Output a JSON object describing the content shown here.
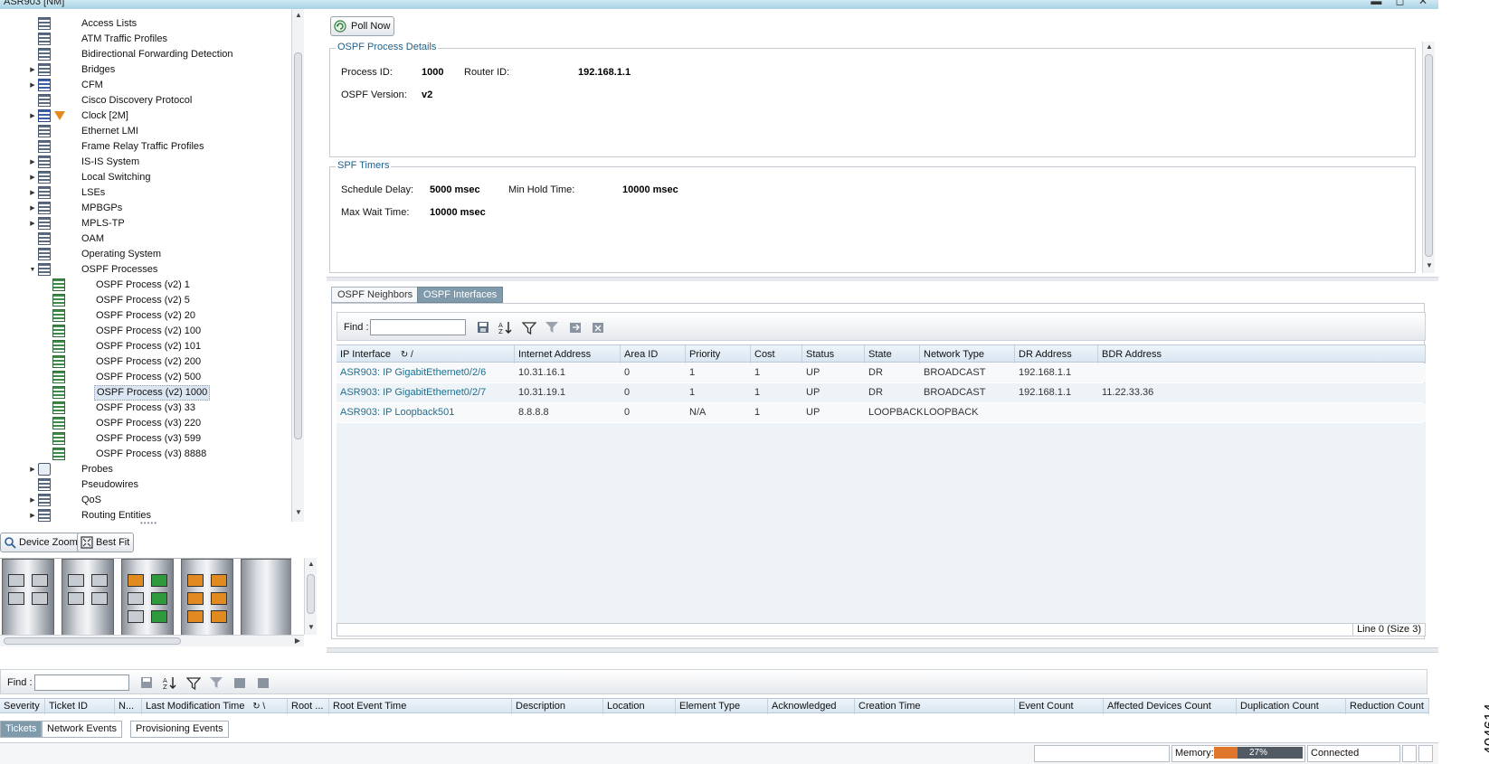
{
  "window": {
    "title": "ASR903 [NM]"
  },
  "tree": {
    "items": [
      {
        "label": "Access Lists",
        "expand": false,
        "icon": "table-icon"
      },
      {
        "label": "ATM Traffic Profiles",
        "expand": false,
        "icon": "table-icon"
      },
      {
        "label": "Bidirectional Forwarding Detection",
        "expand": false,
        "icon": "table-icon"
      },
      {
        "label": "Bridges",
        "expand": true,
        "icon": "table-icon"
      },
      {
        "label": "CFM",
        "expand": true,
        "icon": "cfm-icon"
      },
      {
        "label": "Cisco Discovery Protocol",
        "expand": false,
        "icon": "table-icon"
      },
      {
        "label": "Clock [2M]",
        "expand": true,
        "icon": "clock-icon"
      },
      {
        "label": "Ethernet LMI",
        "expand": false,
        "icon": "table-icon"
      },
      {
        "label": "Frame Relay Traffic Profiles",
        "expand": false,
        "icon": "table-icon"
      },
      {
        "label": "IS-IS System",
        "expand": true,
        "icon": "table-icon"
      },
      {
        "label": "Local Switching",
        "expand": true,
        "icon": "table-icon"
      },
      {
        "label": "LSEs",
        "expand": true,
        "icon": "table-icon"
      },
      {
        "label": "MPBGPs",
        "expand": true,
        "icon": "table-icon"
      },
      {
        "label": "MPLS-TP",
        "expand": true,
        "icon": "table-icon"
      },
      {
        "label": "OAM",
        "expand": false,
        "icon": "table-icon"
      },
      {
        "label": "Operating System",
        "expand": false,
        "icon": "table-icon"
      },
      {
        "label": "OSPF Processes",
        "expand": true,
        "icon": "table-icon"
      }
    ],
    "ospf_children": [
      "OSPF Process (v2) 1",
      "OSPF Process (v2) 5",
      "OSPF Process (v2) 20",
      "OSPF Process (v2) 100",
      "OSPF Process (v2) 101",
      "OSPF Process (v2) 200",
      "OSPF Process (v2) 500",
      "OSPF Process (v2) 1000",
      "OSPF Process (v3) 33",
      "OSPF Process (v3) 220",
      "OSPF Process (v3) 599",
      "OSPF Process (v3) 8888"
    ],
    "selected": "OSPF Process (v2) 1000",
    "after_items": [
      {
        "label": "Probes",
        "expand": true
      },
      {
        "label": "Pseudowires",
        "expand": false
      },
      {
        "label": "QoS",
        "expand": true
      },
      {
        "label": "Routing Entities",
        "expand": true
      }
    ]
  },
  "device_view": {
    "zoom_label": "Device Zoom",
    "fit_label": "Best Fit"
  },
  "toolbar": {
    "poll_label": "Poll Now"
  },
  "process_details": {
    "legend": "OSPF Process Details",
    "process_id_label": "Process ID:",
    "process_id": "1000",
    "router_id_label": "Router ID:",
    "router_id": "192.168.1.1",
    "version_label": "OSPF Version:",
    "version": "v2"
  },
  "spf_timers": {
    "legend": "SPF Timers",
    "schedule_delay_label": "Schedule Delay:",
    "schedule_delay": "5000 msec",
    "min_hold_label": "Min Hold Time:",
    "min_hold": "10000 msec",
    "max_wait_label": "Max Wait Time:",
    "max_wait": "10000 msec"
  },
  "tabs": [
    "OSPF Neighbors",
    "OSPF Interfaces"
  ],
  "active_tab": "OSPF Interfaces",
  "interfaces": {
    "find_label": "Find :",
    "find_value": "",
    "columns": [
      "IP Interface",
      "Internet Address",
      "Area ID",
      "Priority",
      "Cost",
      "Status",
      "State",
      "Network Type",
      "DR Address",
      "BDR Address"
    ],
    "rows": [
      [
        "ASR903: IP GigabitEthernet0/2/6",
        "10.31.16.1",
        "0",
        "1",
        "1",
        "UP",
        "DR",
        "BROADCAST",
        "192.168.1.1",
        ""
      ],
      [
        "ASR903: IP GigabitEthernet0/2/7",
        "10.31.19.1",
        "0",
        "1",
        "1",
        "UP",
        "DR",
        "BROADCAST",
        "192.168.1.1",
        "11.22.33.36"
      ],
      [
        "ASR903: IP Loopback501",
        "8.8.8.8",
        "0",
        "N/A",
        "1",
        "UP",
        "LOOPBACK",
        "LOOPBACK",
        "",
        ""
      ]
    ],
    "footer": "Line 0 (Size 3)"
  },
  "bottom": {
    "find_label": "Find :",
    "find_value": "",
    "columns": [
      "Severity",
      "Ticket ID",
      "N...",
      "Last Modification Time",
      "Root ...",
      "Root Event Time",
      "Description",
      "Location",
      "Element Type",
      "Acknowledged",
      "Creation Time",
      "Event Count",
      "Affected Devices Count",
      "Duplication Count",
      "Reduction Count"
    ],
    "tabs": [
      "Tickets",
      "Network Events",
      "Provisioning Events"
    ],
    "active_tab": "Tickets"
  },
  "status_bar": {
    "memory_label": "Memory:",
    "memory_percent": "27%",
    "memory_fraction": 0.27,
    "connection": "Connected"
  },
  "figure_code": "404614",
  "colors": {
    "accent": "#7f9aab",
    "link": "#1f6e8f",
    "legend": "#1c5f8a",
    "memory": "#e0762c"
  }
}
